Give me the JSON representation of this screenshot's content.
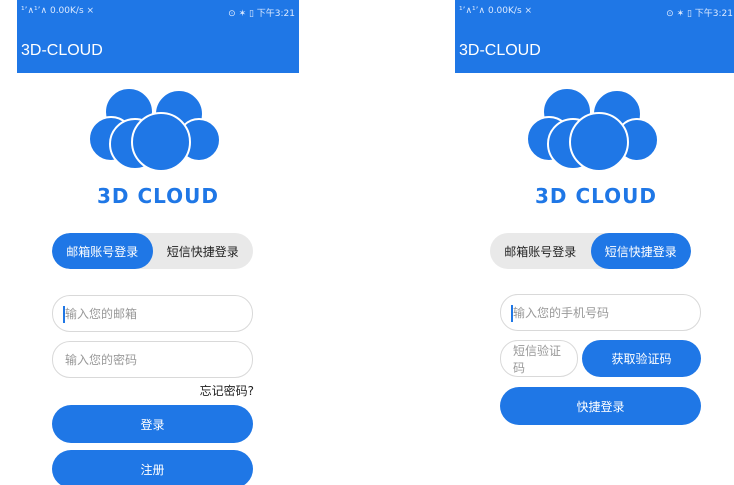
{
  "status_bar": {
    "signal": "¹’∧¹’∧ 0.00K/s ⨯",
    "right": "⊙ ✶ ▯ 下午3:21"
  },
  "app": {
    "title": "3D-CLOUD",
    "brand": "3D CLOUD",
    "logo_icon": "cloud-icon",
    "accent": "#1f77e6"
  },
  "email_login": {
    "tabs": [
      {
        "label": "邮箱账号登录",
        "active": true
      },
      {
        "label": "短信快捷登录",
        "active": false
      }
    ],
    "email_placeholder": "输入您的邮箱",
    "password_placeholder": "输入您的密码",
    "forgot": "忘记密码?",
    "login_button": "登录",
    "register_button": "注册"
  },
  "sms_login": {
    "tabs": [
      {
        "label": "邮箱账号登录",
        "active": false
      },
      {
        "label": "短信快捷登录",
        "active": true
      }
    ],
    "phone_placeholder": "输入您的手机号码",
    "code_placeholder": "短信验证码",
    "get_code_button": "获取验证码",
    "quick_login_button": "快捷登录"
  }
}
